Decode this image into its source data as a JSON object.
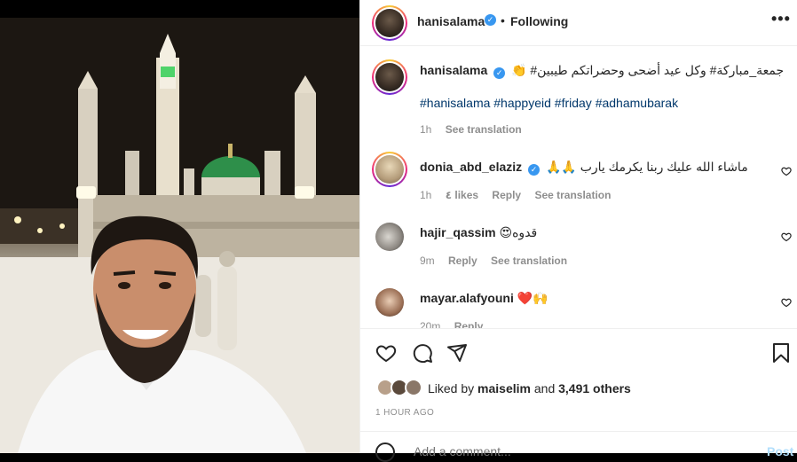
{
  "post": {
    "author": "hanisalama",
    "following_label": "Following",
    "more_label": "•••",
    "caption_arabic": "جمعة_مباركة# وكل عيد أضحى وحضراتكم طيبين# 👏",
    "hashtags": "#hanisalama #happyeid #friday #adhamubarak",
    "caption_time": "1h",
    "caption_translate": "See translation"
  },
  "comments": [
    {
      "user": "donia_abd_elaziz",
      "verified": true,
      "text": "ماشاء الله عليك ربنا يكرمك يارب 🙏🙏",
      "time": "1h",
      "likes": "٤ likes",
      "reply": "Reply",
      "translate": "See translation"
    },
    {
      "user": "hajir_qassim",
      "verified": false,
      "text": "قدوه😍",
      "time": "9m",
      "reply": "Reply",
      "translate": "See translation"
    },
    {
      "user": "mayar.alafyouni",
      "verified": false,
      "text": "❤️🙌",
      "time": "20m",
      "reply": "Reply"
    }
  ],
  "likes": {
    "prefix": "Liked by ",
    "user": "maiselim",
    "middle": " and ",
    "count": "3,491 others"
  },
  "timestamp": "1 HOUR AGO",
  "add_comment": {
    "placeholder": "Add a comment...",
    "post_label": "Post"
  },
  "icons": {
    "like": "heart-icon",
    "comment": "comment-icon",
    "share": "paper-plane-icon",
    "save": "bookmark-icon",
    "emoji": "emoji-icon",
    "verified": "verified-badge-icon"
  },
  "colors": {
    "verified": "#3897f0",
    "hashtag": "#00376b",
    "muted": "#8e8e8e",
    "post_button": "#b2dffc"
  }
}
